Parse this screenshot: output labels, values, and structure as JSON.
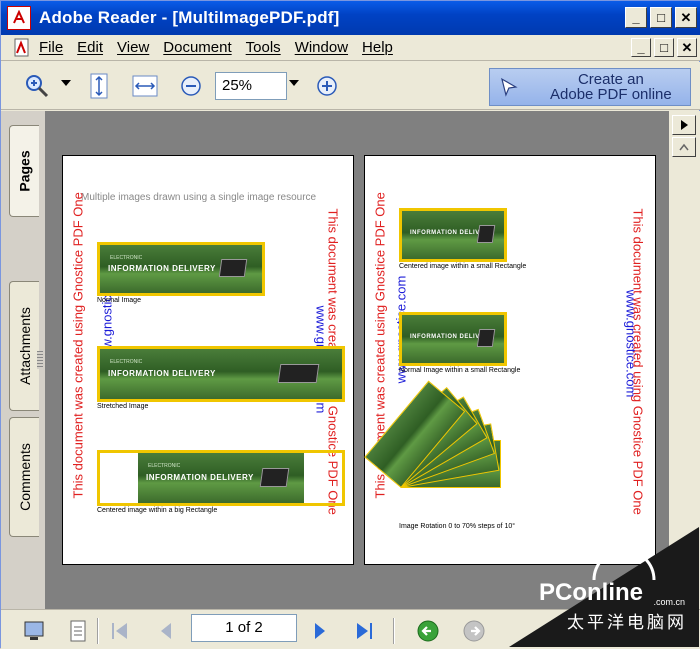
{
  "window": {
    "title": "Adobe Reader - [MultiImagePDF.pdf]",
    "minimize": "_",
    "maximize": "□",
    "close": "✕"
  },
  "menu": {
    "items": [
      "File",
      "Edit",
      "View",
      "Document",
      "Tools",
      "Window",
      "Help"
    ]
  },
  "toolbar": {
    "zoom_value": "25%",
    "create_pdf_line1": "Create an",
    "create_pdf_line2": "Adobe PDF online"
  },
  "tabs": [
    "Pages",
    "Attachments",
    "Comments"
  ],
  "page1": {
    "title": "Multiple images drawn using a single image resource",
    "side_red": "This document was created using Gnostice PDF One",
    "side_blue": "www.gnostice.com",
    "banner_text": "INFORMATION DELIVERY",
    "banner_sub": "ELECTRONIC",
    "cap_normal": "Normal Image",
    "cap_stretched": "Stretched Image",
    "cap_centered": "Centered image within a big Rectangle"
  },
  "page2": {
    "side_red": "This document was created using Gnostice PDF One",
    "side_blue": "www.gnostice.com",
    "cap_centered_small": "Centered image within a small Rectangle",
    "cap_normal_small": "Normal Image within a small Rectangle",
    "cap_rotation": "Image Rotation 0 to 70% steps of 10°"
  },
  "navbar": {
    "page_indicator": "1 of 2"
  },
  "watermark": {
    "logo": "PConline",
    "domain": ".com.cn",
    "chinese": "太平洋电脑网"
  },
  "colors": {
    "titlebar": "#0a5ce8",
    "frame": "#f0c600",
    "red_text": "#e02020",
    "blue_text": "#1c1cd8"
  }
}
